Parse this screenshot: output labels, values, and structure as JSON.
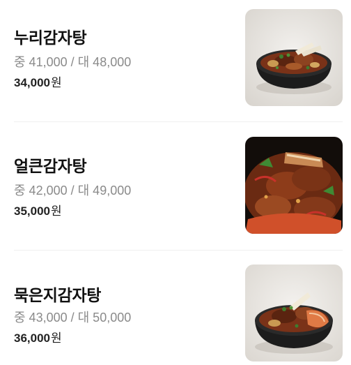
{
  "menu": {
    "items": [
      {
        "name": "누리감자탕",
        "sizes": "중 41,000 / 대 48,000",
        "price": "34,000",
        "unit": "원",
        "image_icon": "pork-bone-stew-in-black-bowl"
      },
      {
        "name": "얼큰감자탕",
        "sizes": "중 42,000 / 대 49,000",
        "price": "35,000",
        "unit": "원",
        "image_icon": "spicy-pork-bone-stew-closeup"
      },
      {
        "name": "묵은지감자탕",
        "sizes": "중 43,000 / 대 50,000",
        "price": "36,000",
        "unit": "원",
        "image_icon": "aged-kimchi-pork-bone-stew"
      }
    ]
  },
  "colors": {
    "title": "#111111",
    "sizes": "#8a8a8a",
    "price": "#222222",
    "divider": "#efefef"
  }
}
